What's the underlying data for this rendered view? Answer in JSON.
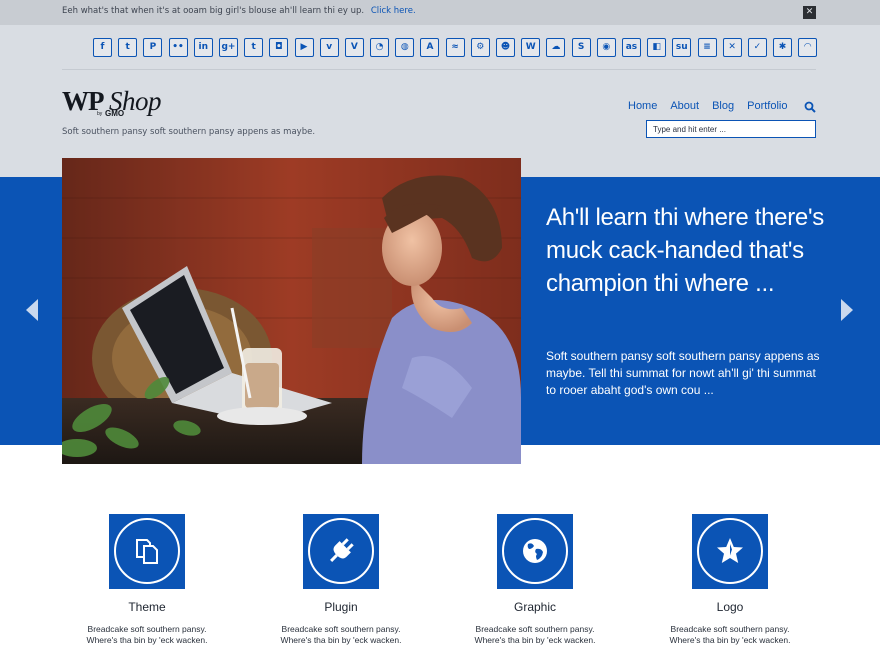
{
  "notice": {
    "text": "Eeh what's that when it's at ooam big girl's blouse ah'll learn thi ey up.",
    "link": "Click here.",
    "close": "✕"
  },
  "social": [
    {
      "name": "facebook",
      "glyph": "f"
    },
    {
      "name": "twitter",
      "glyph": "t"
    },
    {
      "name": "pinterest",
      "glyph": "P"
    },
    {
      "name": "flickr",
      "glyph": "••"
    },
    {
      "name": "linkedin",
      "glyph": "in"
    },
    {
      "name": "google-plus",
      "glyph": "g+"
    },
    {
      "name": "tumblr",
      "glyph": "t"
    },
    {
      "name": "instagram",
      "glyph": "◘"
    },
    {
      "name": "youtube",
      "glyph": "▶"
    },
    {
      "name": "vimeo",
      "glyph": "v"
    },
    {
      "name": "vine",
      "glyph": "V"
    },
    {
      "name": "picasa",
      "glyph": "◔"
    },
    {
      "name": "dribbble",
      "glyph": "◍"
    },
    {
      "name": "deviantart",
      "glyph": "A"
    },
    {
      "name": "delicious",
      "glyph": "≈"
    },
    {
      "name": "steam",
      "glyph": "⚙"
    },
    {
      "name": "reddit-alien",
      "glyph": "☻"
    },
    {
      "name": "wordpress",
      "glyph": "W"
    },
    {
      "name": "soundcloud",
      "glyph": "☁"
    },
    {
      "name": "skype",
      "glyph": "S"
    },
    {
      "name": "reddit",
      "glyph": "◉"
    },
    {
      "name": "lastfm",
      "glyph": "as"
    },
    {
      "name": "delicious-squares",
      "glyph": "◧"
    },
    {
      "name": "stumbleupon",
      "glyph": "su"
    },
    {
      "name": "stack-overflow",
      "glyph": "≡"
    },
    {
      "name": "xing",
      "glyph": "✕"
    },
    {
      "name": "foursquare",
      "glyph": "✓"
    },
    {
      "name": "yelp",
      "glyph": "✱"
    },
    {
      "name": "rss",
      "glyph": "◠"
    }
  ],
  "brand": {
    "wp": "WP",
    "shop": "Shop",
    "by": "by",
    "gmo": "GMO",
    "tagline": "Soft southern pansy soft southern pansy appens as maybe."
  },
  "nav": {
    "items": [
      "Home",
      "About",
      "Blog",
      "Portfolio"
    ],
    "search_placeholder": "Type and hit enter ..."
  },
  "hero": {
    "title": "Ah'll learn thi where there's muck cack-handed that's champion thi where ...",
    "description": "Soft southern pansy soft southern pansy appens as maybe. Tell thi summat for nowt ah'll gi' thi summat to rooer abaht god's own cou ..."
  },
  "features": [
    {
      "title": "Theme",
      "icon": "documents-icon",
      "desc_line1": "Breadcake soft southern pansy.",
      "desc_line2": "Where's tha bin by 'eck wacken."
    },
    {
      "title": "Plugin",
      "icon": "plug-icon",
      "desc_line1": "Breadcake soft southern pansy.",
      "desc_line2": "Where's tha bin by 'eck wacken."
    },
    {
      "title": "Graphic",
      "icon": "globe-icon",
      "desc_line1": "Breadcake soft southern pansy.",
      "desc_line2": "Where's tha bin by 'eck wacken."
    },
    {
      "title": "Logo",
      "icon": "star-icon",
      "desc_line1": "Breadcake soft southern pansy.",
      "desc_line2": "Where's tha bin by 'eck wacken."
    }
  ],
  "colors": {
    "accent": "#0b54b5",
    "header_bg": "#d9dde3",
    "notice_bg": "#c8ccd2"
  }
}
